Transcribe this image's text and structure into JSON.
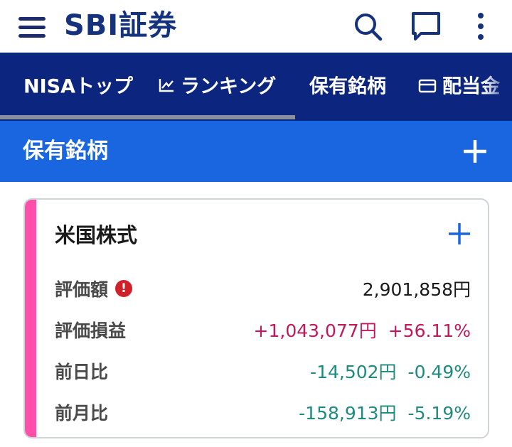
{
  "appbar": {
    "logo_text": "SBI証券",
    "icons": [
      "hamburger-menu-icon",
      "search-icon",
      "chat-icon",
      "more-vertical-icon"
    ]
  },
  "tabs": [
    {
      "label": "NISAトップ",
      "icon": ""
    },
    {
      "label": "ランキング",
      "icon": "chart-icon"
    },
    {
      "label": "保有銘柄",
      "icon": ""
    },
    {
      "label": "配当金",
      "icon": "card-icon"
    }
  ],
  "section": {
    "title": "保有銘柄"
  },
  "card": {
    "title": "米国株式",
    "rows": [
      {
        "label": "評価額",
        "value": "2,901,858円",
        "warning": "!"
      },
      {
        "label": "評価損益",
        "value": "+1,043,077円",
        "pct": "+56.11%"
      },
      {
        "label": "前日比",
        "value": "-14,502円",
        "pct": "-0.49%"
      },
      {
        "label": "前月比",
        "value": "-158,913円",
        "pct": "-5.19%"
      }
    ]
  },
  "colors": {
    "brand_navy": "#14327e",
    "tabbar": "#0c2680",
    "section_blue": "#1a66e0",
    "accent_pink": "#ff4fa8",
    "positive": "#c2185b",
    "negative": "#1f8a7d",
    "warning": "#d0202a"
  }
}
